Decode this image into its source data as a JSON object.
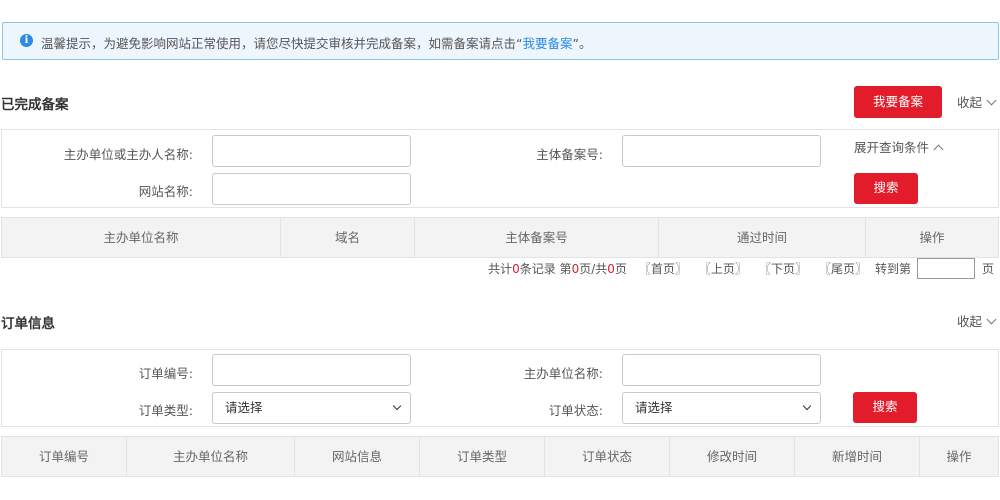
{
  "notice": {
    "icon": "info-icon",
    "text_before": "温馨提示，为避免影响网站正常使用，请您尽快提交审核并完成备案，如需备案请点击“",
    "link": "我要备案",
    "text_after": "”。"
  },
  "completed": {
    "title": "已完成备案",
    "apply_button": "我要备案",
    "collapse_label": "收起",
    "filters": {
      "organizer_label": "主办单位或主办人名称:",
      "entity_no_label": "主体备案号:",
      "site_name_label": "网站名称:",
      "expand_label": "展开查询条件",
      "search_button": "搜索"
    },
    "columns": [
      "主办单位名称",
      "域名",
      "主体备案号",
      "通过时间",
      "操作"
    ],
    "pager": {
      "prefix": "共计",
      "records": "0",
      "mid1": "条记录 第",
      "page": "0",
      "mid2": "页/共",
      "total_pages": "0",
      "suffix": "页",
      "first": "〖首页〗",
      "prev": "〖上页〗",
      "next": "〖下页〗",
      "last": "〖尾页〗",
      "goto_label": "转到第",
      "goto_suffix": "页"
    }
  },
  "orders": {
    "title": "订单信息",
    "collapse_label": "收起",
    "filters": {
      "order_no_label": "订单编号:",
      "organizer_label": "主办单位名称:",
      "order_type_label": "订单类型:",
      "order_type_value": "请选择",
      "order_status_label": "订单状态:",
      "order_status_value": "请选择",
      "search_button": "搜索"
    },
    "columns": [
      "订单编号",
      "主办单位名称",
      "网站信息",
      "订单类型",
      "订单状态",
      "修改时间",
      "新增时间",
      "操作"
    ]
  },
  "colors": {
    "accent": "#e21c2a",
    "link": "#2b8ae6",
    "header_bg": "#f3f3f3"
  }
}
